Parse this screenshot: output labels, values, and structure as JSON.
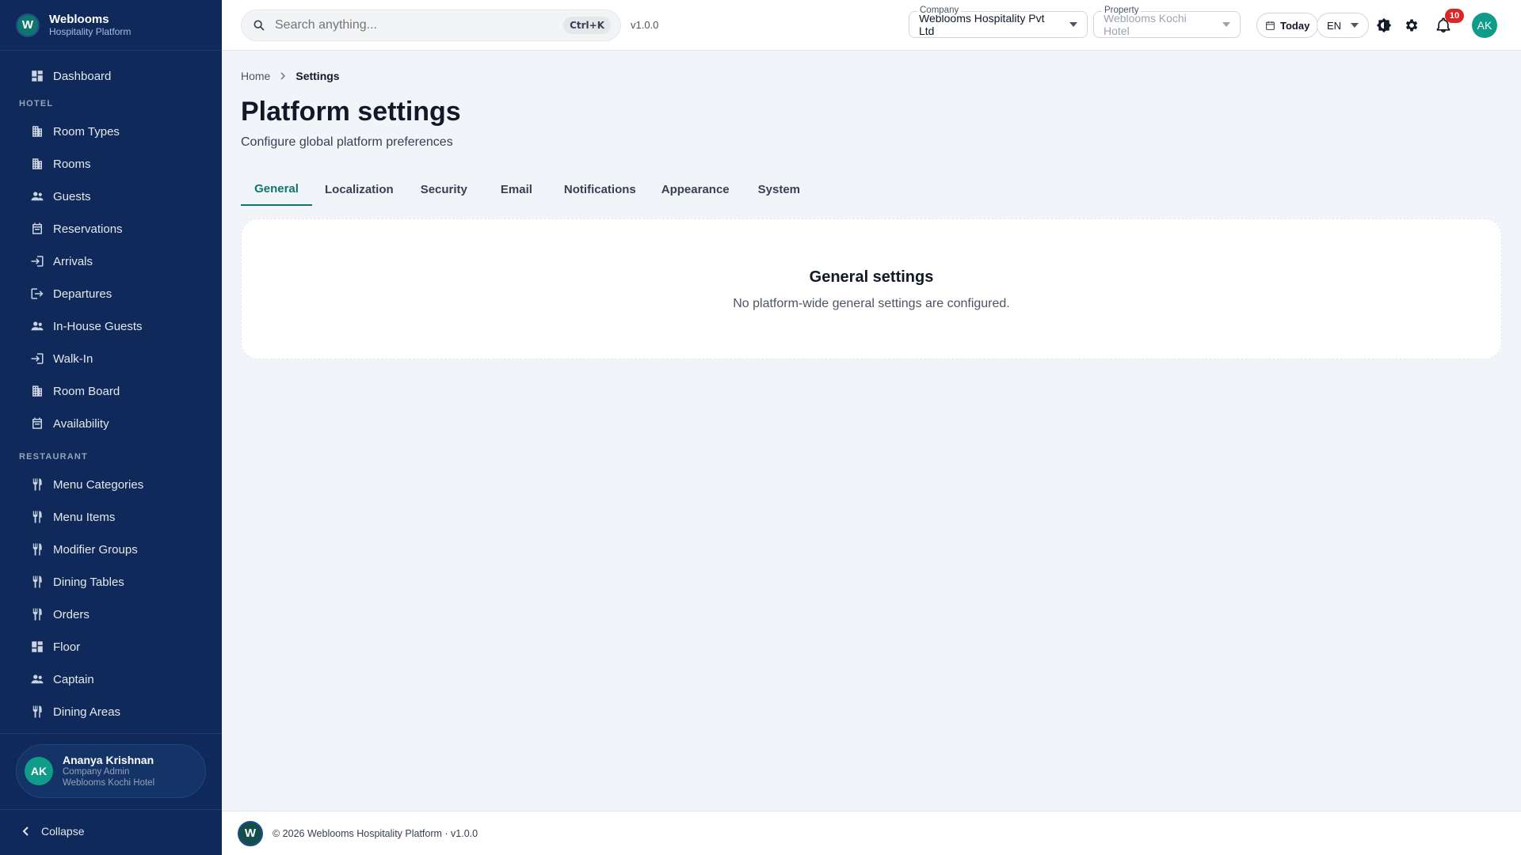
{
  "brand": {
    "logo_letter": "W",
    "name": "Weblooms",
    "subtitle": "Hospitality Platform"
  },
  "sidebar": {
    "dashboard": {
      "label": "Dashboard",
      "icon": "dashboard-icon"
    },
    "sections": [
      {
        "title": "HOTEL",
        "items": [
          {
            "label": "Room Types",
            "icon": "building-icon"
          },
          {
            "label": "Rooms",
            "icon": "building-icon"
          },
          {
            "label": "Guests",
            "icon": "people-icon"
          },
          {
            "label": "Reservations",
            "icon": "calendar-icon"
          },
          {
            "label": "Arrivals",
            "icon": "login-icon"
          },
          {
            "label": "Departures",
            "icon": "logout-icon"
          },
          {
            "label": "In-House Guests",
            "icon": "people-icon"
          },
          {
            "label": "Walk-In",
            "icon": "login-icon"
          },
          {
            "label": "Room Board",
            "icon": "building-icon"
          },
          {
            "label": "Availability",
            "icon": "calendar-icon"
          }
        ]
      },
      {
        "title": "RESTAURANT",
        "items": [
          {
            "label": "Menu Categories",
            "icon": "utensils-icon"
          },
          {
            "label": "Menu Items",
            "icon": "utensils-icon"
          },
          {
            "label": "Modifier Groups",
            "icon": "utensils-icon"
          },
          {
            "label": "Dining Tables",
            "icon": "utensils-icon"
          },
          {
            "label": "Orders",
            "icon": "utensils-icon"
          },
          {
            "label": "Floor",
            "icon": "dashboard-icon"
          },
          {
            "label": "Captain",
            "icon": "people-icon"
          },
          {
            "label": "Dining Areas",
            "icon": "utensils-icon"
          }
        ]
      }
    ],
    "user": {
      "initials": "AK",
      "name": "Ananya Krishnan",
      "role": "Company Admin",
      "property": "Weblooms Kochi Hotel"
    },
    "collapse_label": "Collapse"
  },
  "topbar": {
    "search_placeholder": "Search anything...",
    "shortcut": "Ctrl+K",
    "version": "v1.0.0",
    "company": {
      "label": "Company",
      "value": "Weblooms Hospitality Pvt Ltd"
    },
    "property": {
      "label": "Property",
      "value": "Weblooms Kochi Hotel"
    },
    "today_label": "Today",
    "language": "EN",
    "notifications_count": "10",
    "avatar_initials": "AK"
  },
  "main": {
    "breadcrumb": {
      "home": "Home",
      "current": "Settings"
    },
    "title": "Platform settings",
    "subtitle": "Configure global platform preferences",
    "tabs": [
      "General",
      "Localization",
      "Security",
      "Email",
      "Notifications",
      "Appearance",
      "System"
    ],
    "active_tab": "General",
    "card": {
      "title": "General settings",
      "text": "No platform-wide general settings are configured."
    }
  },
  "footer": {
    "logo_letter": "W",
    "text": "© 2026 Weblooms Hospitality Platform · v1.0.0"
  },
  "colors": {
    "sidebar_bg": "#0f2a5a",
    "accent": "#0f766e",
    "badge": "#dc2626",
    "avatar": "#0f9d8a"
  }
}
